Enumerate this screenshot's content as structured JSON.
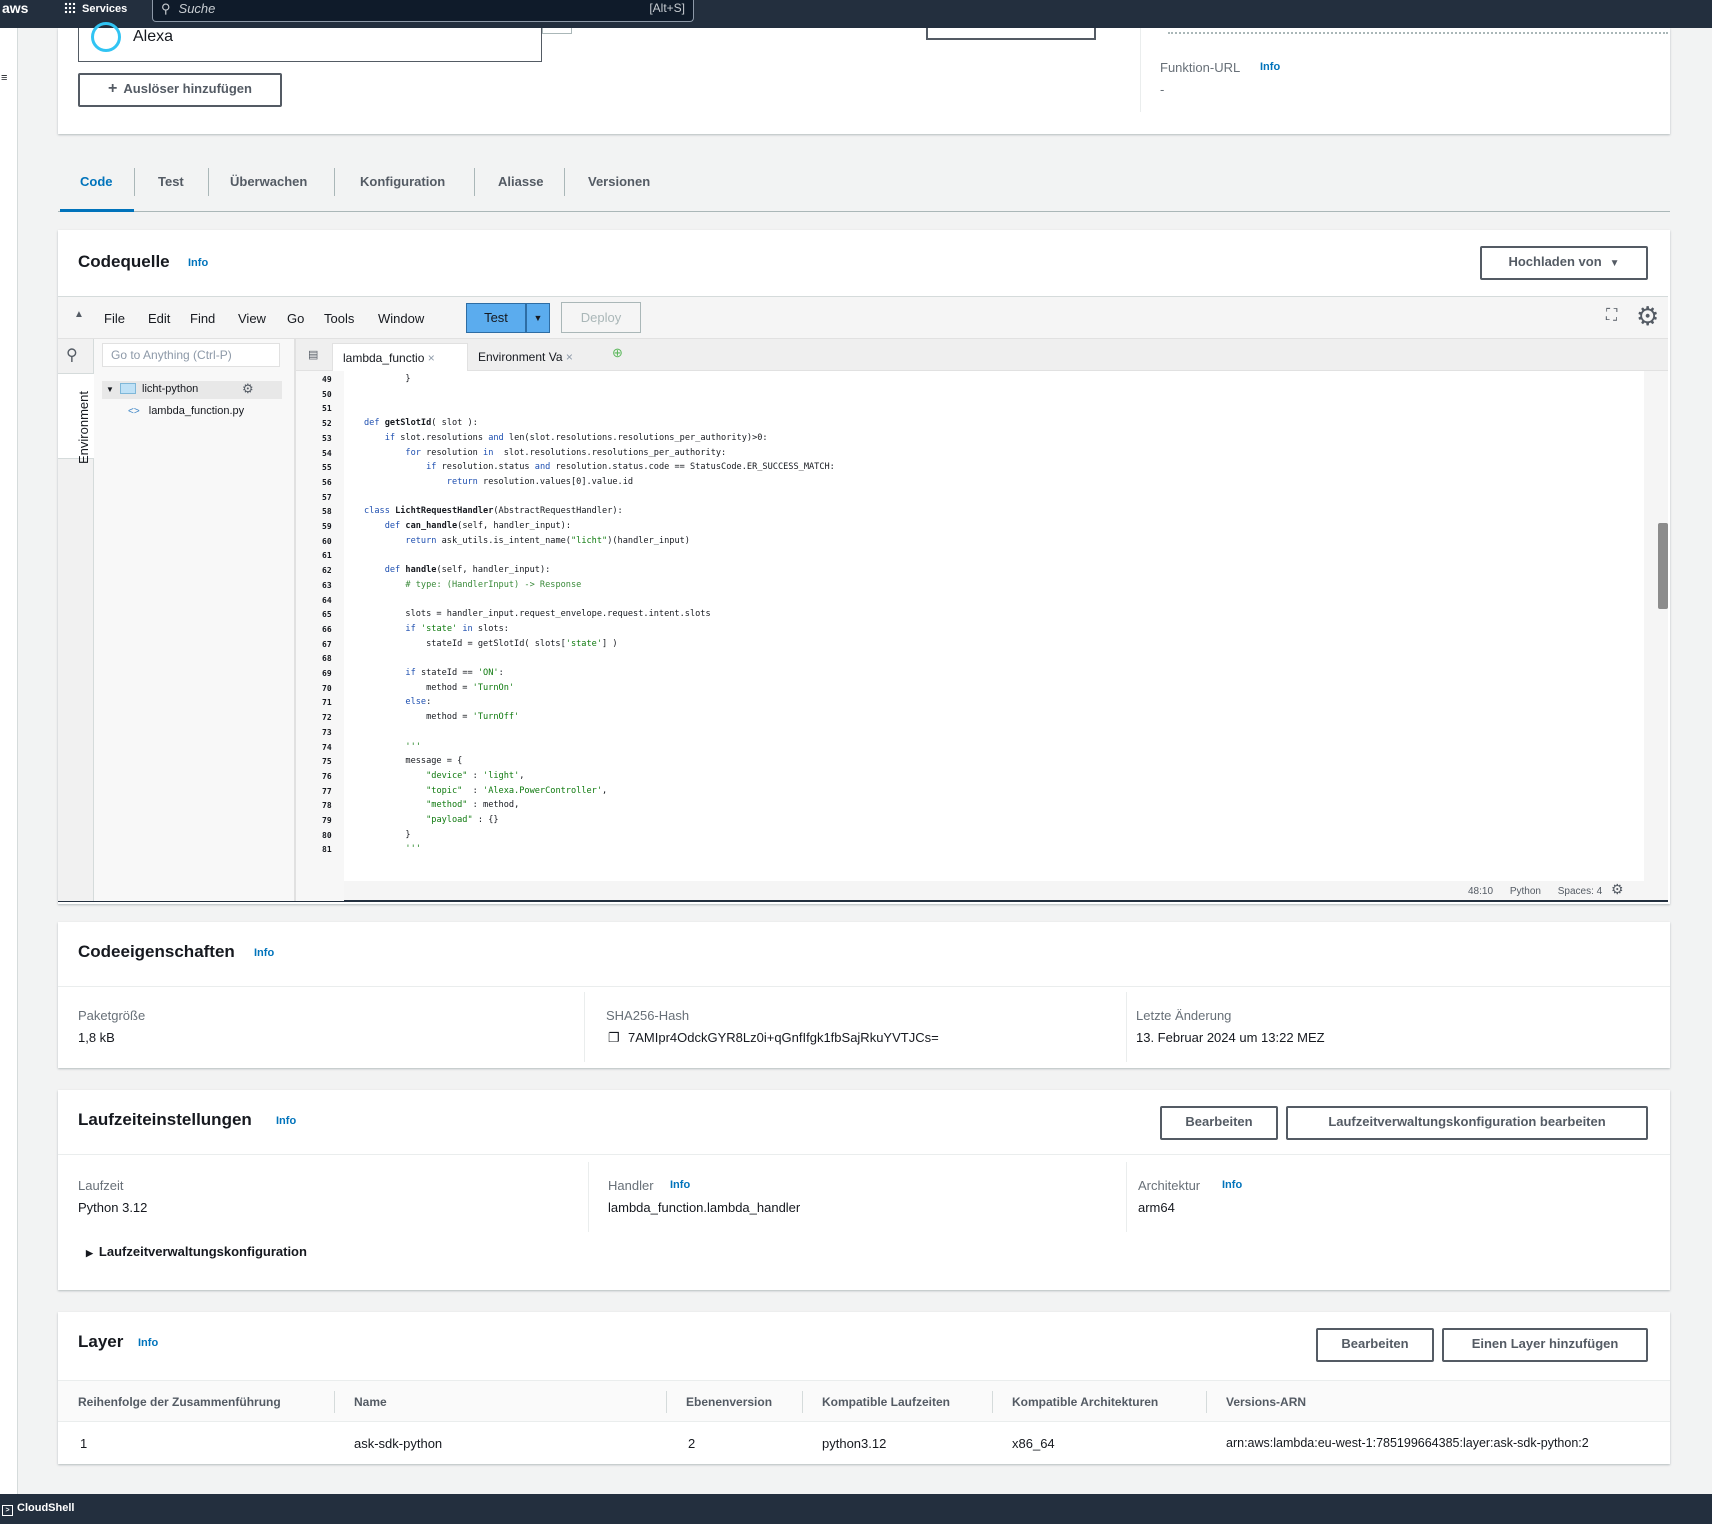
{
  "topbar": {
    "logo": "aws",
    "services_label": "Services",
    "search_placeholder": "Suche",
    "search_shortcut": "[Alt+S]"
  },
  "trigger": {
    "name": "Alexa",
    "add_trigger_label": "Auslöser hinzufügen",
    "function_url_label": "Funktion-URL",
    "function_url_info": "Info",
    "function_url_value": "-"
  },
  "tabs": [
    "Code",
    "Test",
    "Überwachen",
    "Konfiguration",
    "Aliasse",
    "Versionen"
  ],
  "code_source": {
    "title": "Codequelle",
    "info": "Info",
    "upload_label": "Hochladen von",
    "menu": [
      "File",
      "Edit",
      "Find",
      "View",
      "Go",
      "Tools",
      "Window"
    ],
    "test_label": "Test",
    "deploy_label": "Deploy",
    "goto_placeholder": "Go to Anything (Ctrl-P)",
    "env_label": "Environment",
    "folder_name": "licht-python",
    "file_name": "lambda_function.py",
    "editor_tabs": [
      "lambda_functio",
      "Environment Va"
    ],
    "status": {
      "cursor": "48:10",
      "language": "Python",
      "spaces": "Spaces: 4"
    },
    "line_numbers": [
      "49",
      "50",
      "51",
      "52",
      "53",
      "54",
      "55",
      "56",
      "57",
      "58",
      "59",
      "60",
      "61",
      "62",
      "63",
      "64",
      "65",
      "66",
      "67",
      "68",
      "69",
      "70",
      "71",
      "72",
      "73",
      "74",
      "75",
      "76",
      "77",
      "78",
      "79",
      "80",
      "81"
    ],
    "code_lines": [
      "        }",
      "",
      "",
      "def getSlotId( slot ):",
      "    if slot.resolutions and len(slot.resolutions.resolutions_per_authority)>0:",
      "        for resolution in  slot.resolutions.resolutions_per_authority:",
      "            if resolution.status and resolution.status.code == StatusCode.ER_SUCCESS_MATCH:",
      "                return resolution.values[0].value.id",
      "",
      "class LichtRequestHandler(AbstractRequestHandler):",
      "    def can_handle(self, handler_input):",
      "        return ask_utils.is_intent_name(\"licht\")(handler_input)",
      "",
      "    def handle(self, handler_input):",
      "        # type: (HandlerInput) -> Response",
      "",
      "        slots = handler_input.request_envelope.request.intent.slots",
      "        if 'state' in slots:",
      "            stateId = getSlotId( slots['state'] )",
      "",
      "        if stateId == 'ON':",
      "            method = 'TurnOn'",
      "        else:",
      "            method = 'TurnOff'",
      "",
      "        '''",
      "        message = {",
      "            \"device\" : 'light',",
      "            \"topic\"  : 'Alexa.PowerController',",
      "            \"method\" : method,",
      "            \"payload\" : {}",
      "        }",
      "        '''"
    ]
  },
  "code_props": {
    "title": "Codeeigenschaften",
    "info": "Info",
    "package_size_label": "Paketgröße",
    "package_size": "1,8 kB",
    "sha_label": "SHA256-Hash",
    "sha_value": "7AMIpr4OdckGYR8Lz0i+qGnfIfgk1fbSajRkuYVTJCs=",
    "modified_label": "Letzte Änderung",
    "modified_value": "13. Februar 2024 um 13:22 MEZ"
  },
  "runtime": {
    "title": "Laufzeiteinstellungen",
    "info": "Info",
    "edit_label": "Bearbeiten",
    "edit_mgmt_label": "Laufzeitverwaltungskonfiguration bearbeiten",
    "runtime_label": "Laufzeit",
    "runtime_value": "Python 3.12",
    "handler_label": "Handler",
    "handler_value": "lambda_function.lambda_handler",
    "arch_label": "Architektur",
    "arch_value": "arm64",
    "mgmt_expander": "Laufzeitverwaltungskonfiguration"
  },
  "layers": {
    "title": "Layer",
    "info": "Info",
    "edit_label": "Bearbeiten",
    "add_label": "Einen Layer hinzufügen",
    "columns": [
      "Reihenfolge der Zusammenführung",
      "Name",
      "Ebenenversion",
      "Kompatible Laufzeiten",
      "Kompatible Architekturen",
      "Versions-ARN"
    ],
    "rows": [
      [
        "1",
        "ask-sdk-python",
        "2",
        "python3.12",
        "x86_64",
        "arn:aws:lambda:eu-west-1:785199664385:layer:ask-sdk-python:2"
      ]
    ]
  },
  "bottombar": {
    "cloudshell": "CloudShell"
  }
}
